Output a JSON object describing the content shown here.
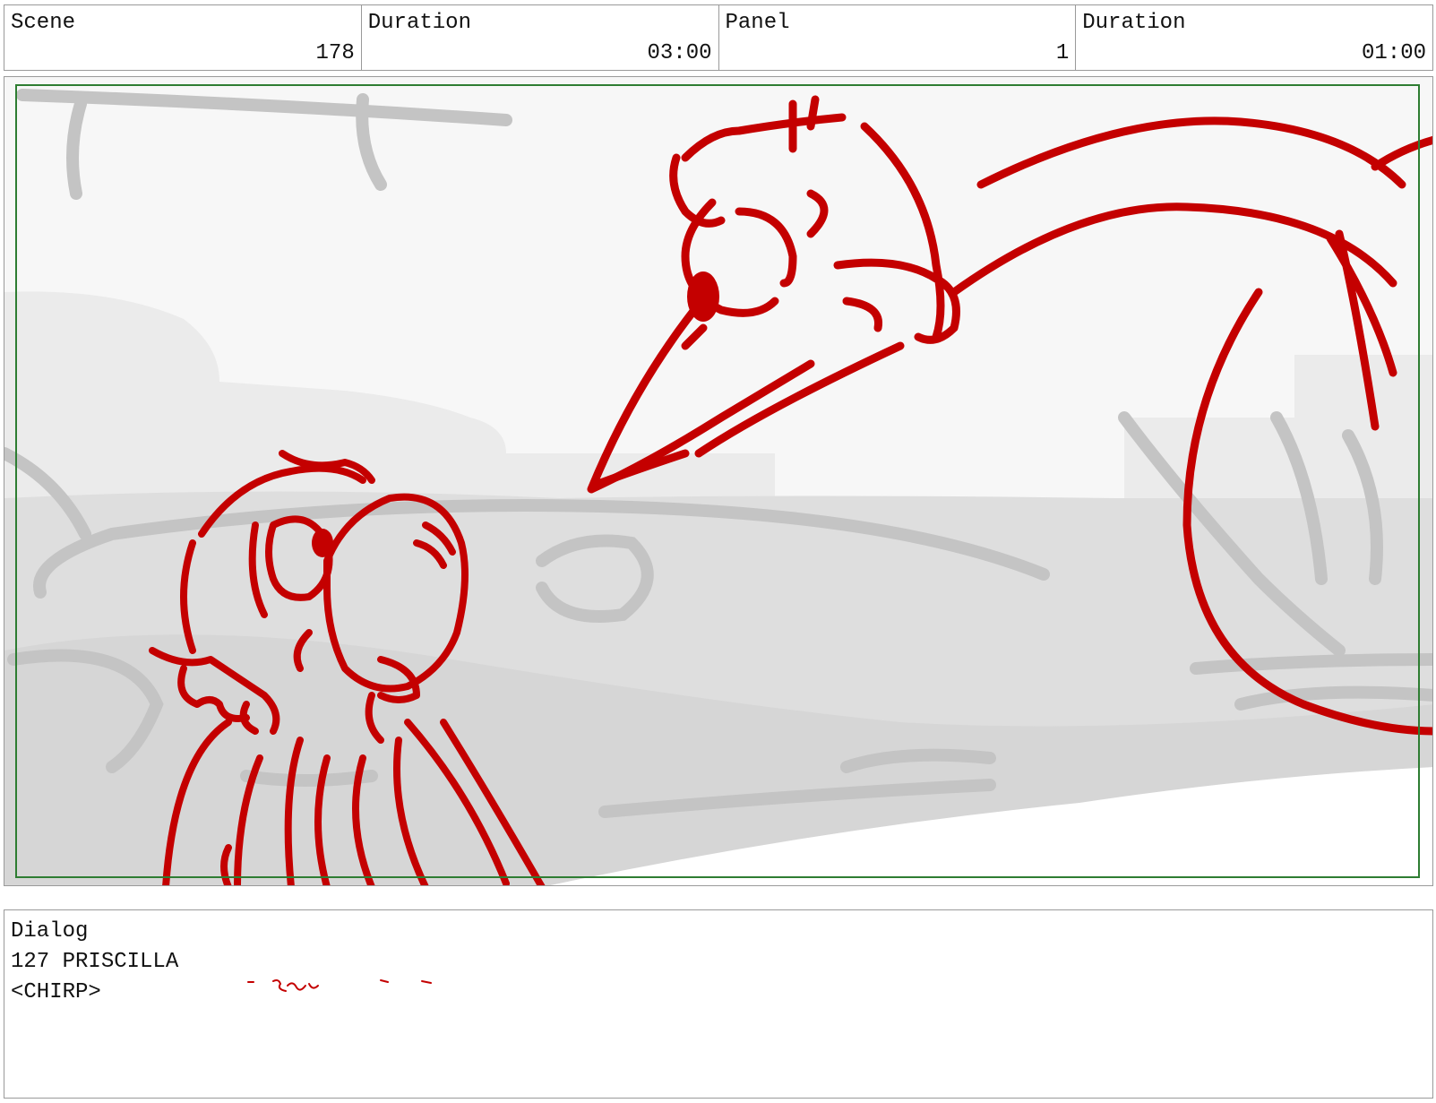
{
  "header": {
    "scene_label": "Scene",
    "scene_value": "178",
    "scene_duration_label": "Duration",
    "scene_duration_value": "03:00",
    "panel_label": "Panel",
    "panel_value": "1",
    "panel_duration_label": "Duration",
    "panel_duration_value": "01:00"
  },
  "panel_image": {
    "description_icon": "storyboard-sketch",
    "line_color": "#c40000",
    "background_color": "#dcdcdc",
    "safe_frame_color": "#2e7d32"
  },
  "dialog": {
    "label": "Dialog",
    "line1": "127 PRISCILLA",
    "line2": "<CHIRP>"
  }
}
